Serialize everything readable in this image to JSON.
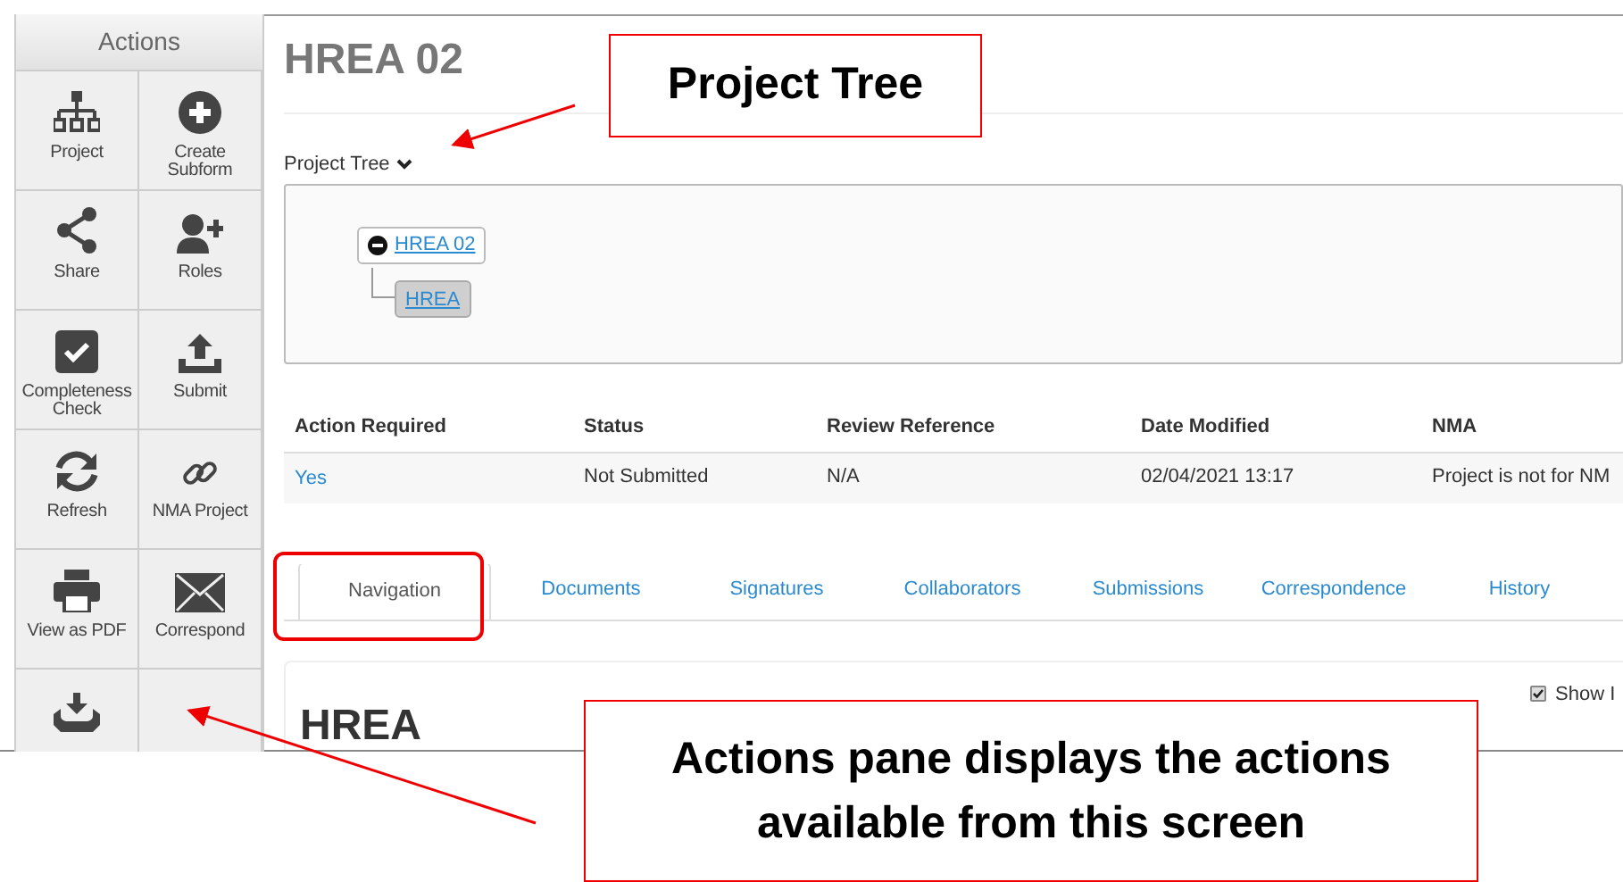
{
  "actions_pane": {
    "title": "Actions",
    "items": [
      {
        "label": "Project"
      },
      {
        "label": "Create Subform"
      },
      {
        "label": "Share"
      },
      {
        "label": "Roles"
      },
      {
        "label": "Completeness Check"
      },
      {
        "label": "Submit"
      },
      {
        "label": "Refresh"
      },
      {
        "label": "NMA Project"
      },
      {
        "label": "View as PDF"
      },
      {
        "label": "Correspond"
      }
    ]
  },
  "page_title": "HREA 02",
  "project_tree": {
    "label": "Project Tree",
    "nodes": [
      {
        "label": "HREA 02",
        "expanded": true,
        "selected": false,
        "children": [
          {
            "label": "HREA",
            "selected": true
          }
        ]
      }
    ]
  },
  "table": {
    "columns": [
      "Action Required",
      "Status",
      "Review Reference",
      "Date Modified",
      "NMA"
    ],
    "rows": [
      [
        "Yes",
        "Not Submitted",
        "N/A",
        "02/04/2021 13:17",
        "Project is not for NM"
      ]
    ]
  },
  "tabs": [
    {
      "label": "Navigation",
      "selected": true
    },
    {
      "label": "Documents",
      "selected": false
    },
    {
      "label": "Signatures",
      "selected": false
    },
    {
      "label": "Collaborators",
      "selected": false
    },
    {
      "label": "Submissions",
      "selected": false
    },
    {
      "label": "Correspondence",
      "selected": false
    },
    {
      "label": "History",
      "selected": false
    }
  ],
  "section": {
    "heading": "HREA",
    "show_option": {
      "label": "Show I",
      "checked": true
    }
  },
  "callouts": [
    {
      "text": "Project Tree"
    },
    {
      "text": "Actions pane displays the actions available from this screen"
    }
  ]
}
